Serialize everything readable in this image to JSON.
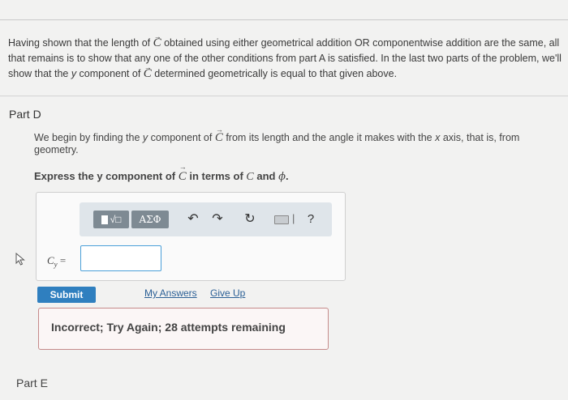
{
  "intro": {
    "t1": "Having shown that the length of ",
    "vec": "C",
    "t2": " obtained using either geometrical addition OR componentwise addition are the same, all that remains is to show that any one of the other conditions from part A is satisfied. In the last two parts of the problem, we'll show that the ",
    "y": "y",
    "t3": " component of ",
    "t4": " determined geometrically is equal to that given above."
  },
  "part_d": {
    "title": "Part D",
    "body1": "We begin by finding the ",
    "body_y": "y",
    "body2": " component of ",
    "body3": " from its length and the angle it makes with the ",
    "body_x": "x",
    "body4": " axis, that is, from geometry.",
    "express1": "Express the y component of ",
    "express2": " in terms of ",
    "express_C": "C",
    "express3": " and ",
    "express_phi": "ϕ",
    "express4": "."
  },
  "toolbar": {
    "templates_label": "√□",
    "greek_label": "ΑΣΦ",
    "undo_icon": "undo-icon",
    "redo_icon": "redo-icon",
    "reset_icon": "reset-icon",
    "keyboard_icon": "keyboard-icon",
    "separator": "|",
    "help_label": "?"
  },
  "answer": {
    "label_var": "C",
    "label_sub": "y",
    "label_eq": " =",
    "value": ""
  },
  "actions": {
    "submit": "Submit",
    "my_answers": "My Answers",
    "give_up": "Give Up"
  },
  "feedback": {
    "text": "Incorrect; Try Again; 28 attempts remaining"
  },
  "part_e": {
    "title": "Part E"
  },
  "colors": {
    "submit_bg": "#2f7fbf",
    "input_border": "#4a9fd8",
    "feedback_border": "#c58a8a",
    "link": "#2a5f95"
  }
}
